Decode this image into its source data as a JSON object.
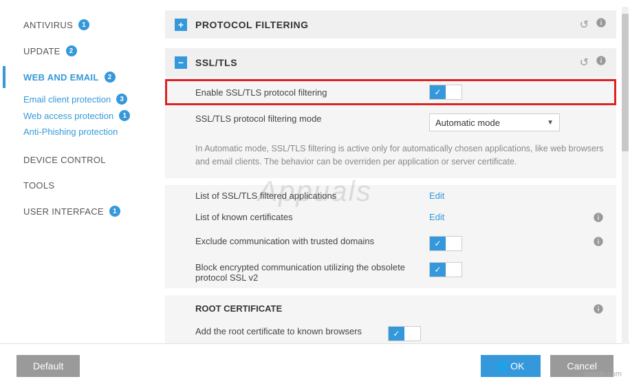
{
  "sidebar": {
    "items": [
      {
        "label": "ANTIVIRUS",
        "badge": "1"
      },
      {
        "label": "UPDATE",
        "badge": "2"
      },
      {
        "label": "WEB AND EMAIL",
        "badge": "2",
        "active": true,
        "subs": [
          {
            "label": "Email client protection",
            "badge": "3"
          },
          {
            "label": "Web access protection",
            "badge": "1"
          },
          {
            "label": "Anti-Phishing protection"
          }
        ]
      },
      {
        "label": "DEVICE CONTROL"
      },
      {
        "label": "TOOLS"
      },
      {
        "label": "USER INTERFACE",
        "badge": "1"
      }
    ]
  },
  "sections": {
    "protocol": {
      "title": "PROTOCOL FILTERING",
      "expand_icon": "+"
    },
    "ssl": {
      "title": "SSL/TLS",
      "expand_icon": "−",
      "rows": {
        "enable": "Enable SSL/TLS protocol filtering",
        "mode_label": "SSL/TLS protocol filtering mode",
        "mode_value": "Automatic mode",
        "help": "In Automatic mode, SSL/TLS filtering is active only for automatically chosen applications, like web browsers and email clients. The behavior can be overriden per application or server certificate.",
        "list_apps": "List of SSL/TLS filtered applications",
        "list_certs": "List of known certificates",
        "edit": "Edit",
        "exclude": "Exclude communication with trusted domains",
        "block_v2": "Block encrypted communication utilizing the obsolete protocol SSL v2"
      },
      "root": {
        "title": "ROOT CERTIFICATE",
        "add": "Add the root certificate to known browsers"
      }
    }
  },
  "footer": {
    "default": "Default",
    "ok": "OK",
    "cancel": "Cancel"
  },
  "watermark": "Appuals",
  "source": "wsxdn.com"
}
